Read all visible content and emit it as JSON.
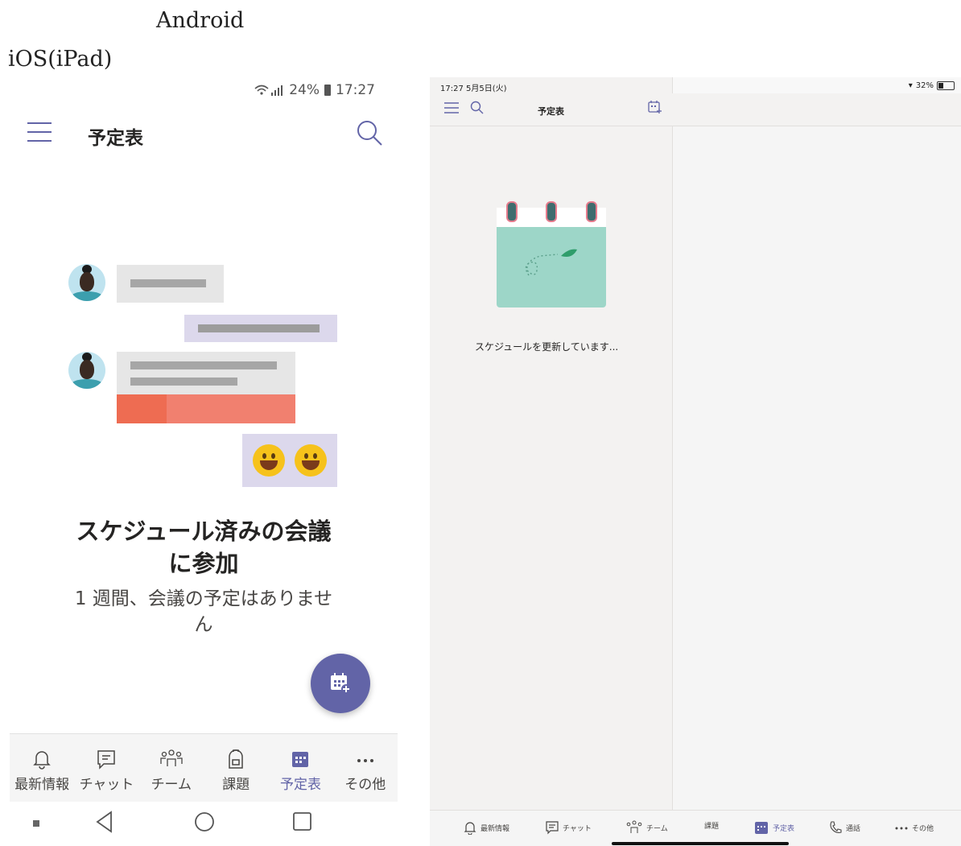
{
  "captions": {
    "android": "Android",
    "ios": "iOS(iPad)"
  },
  "android": {
    "status": {
      "battery": "24%",
      "time": "17:27"
    },
    "title": "予定表",
    "heading": "スケジュール済みの会議に参加",
    "subtext": "1 週間、会議の予定はありません",
    "nav": [
      {
        "label": "最新情報",
        "icon": "bell-icon"
      },
      {
        "label": "チャット",
        "icon": "chat-icon"
      },
      {
        "label": "チーム",
        "icon": "teams-icon"
      },
      {
        "label": "課題",
        "icon": "backpack-icon"
      },
      {
        "label": "予定表",
        "icon": "calendar-icon",
        "active": true
      },
      {
        "label": "その他",
        "icon": "more-icon"
      }
    ]
  },
  "ipad": {
    "status": {
      "time_date": "17:27  5月5日(火)",
      "battery": "32%"
    },
    "title": "予定表",
    "loading": "スケジュールを更新しています...",
    "nav": [
      {
        "label": "最新情報",
        "icon": "bell-icon"
      },
      {
        "label": "チャット",
        "icon": "chat-icon"
      },
      {
        "label": "チーム",
        "icon": "teams-icon"
      },
      {
        "label": "課題",
        "icon": "assignments-icon"
      },
      {
        "label": "予定表",
        "icon": "calendar-icon",
        "active": true
      },
      {
        "label": "通話",
        "icon": "phone-icon"
      },
      {
        "label": "その他",
        "icon": "more-icon"
      }
    ]
  },
  "colors": {
    "accent": "#6264a7",
    "calendar_green": "#9dd6c8"
  }
}
